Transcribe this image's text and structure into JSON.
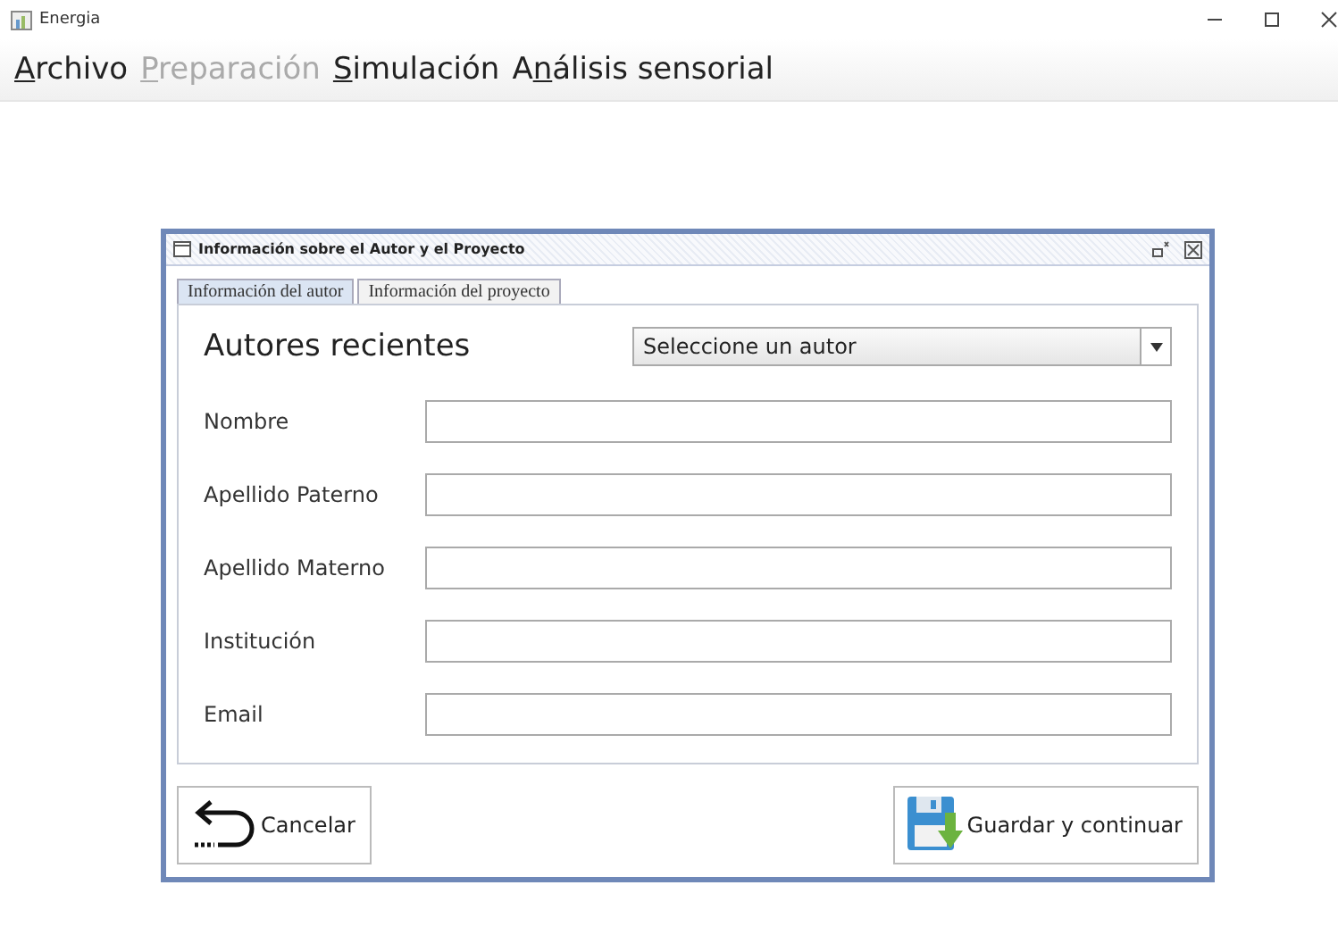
{
  "window": {
    "title": "Energia"
  },
  "menu": [
    {
      "label": [
        {
          "text": "A",
          "underlined": true
        },
        {
          "text": "rchivo",
          "underlined": false
        }
      ],
      "disabled": false
    },
    {
      "label": [
        {
          "text": "P",
          "underlined": true
        },
        {
          "text": "reparación",
          "underlined": false
        }
      ],
      "disabled": true
    },
    {
      "label": [
        {
          "text": "S",
          "underlined": true
        },
        {
          "text": "imulación",
          "underlined": false
        }
      ],
      "disabled": false
    },
    {
      "label": [
        {
          "text": "A",
          "underlined": false
        },
        {
          "text": "n",
          "underlined": true
        },
        {
          "text": "álisis sensorial",
          "underlined": false
        }
      ],
      "disabled": false
    }
  ],
  "dialog": {
    "title": "Información sobre el Autor y el Proyecto",
    "tabs": [
      {
        "label": "Información del autor",
        "selected": true
      },
      {
        "label": "Información del proyecto",
        "selected": false
      }
    ],
    "recent_label": "Autores recientes",
    "author_select": {
      "value": "Seleccione un autor"
    },
    "fields": [
      {
        "label": "Nombre"
      },
      {
        "label": "Apellido Paterno"
      },
      {
        "label": "Apellido Materno"
      },
      {
        "label": "Institución"
      },
      {
        "label": "Email"
      }
    ],
    "cancel_button": "Cancelar",
    "save_button": "Guardar y continuar"
  }
}
